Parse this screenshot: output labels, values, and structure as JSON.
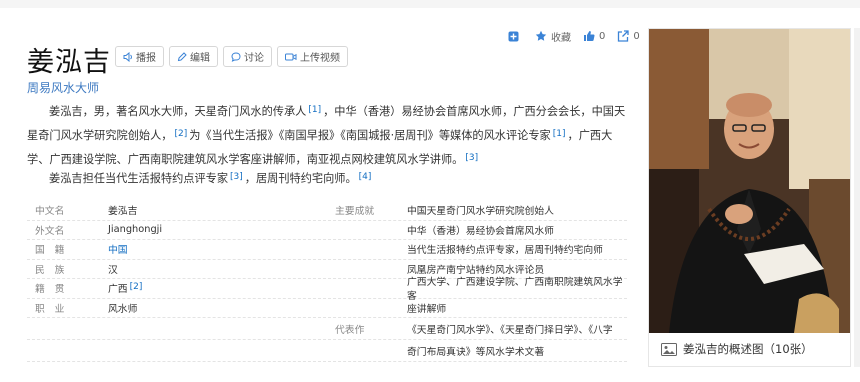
{
  "actions": {
    "collect_label": "收藏",
    "like_count": "0",
    "share_count": "0"
  },
  "header": {
    "title": "姜泓吉",
    "subtitle": "周易风水大师",
    "buttons": [
      "播报",
      "编辑",
      "讨论",
      "上传视频"
    ]
  },
  "summary": {
    "p1_a": "姜泓吉，男，著名风水大师，天星奇门风水的传承人",
    "ref1": "[1]",
    "p1_b": "，中华（香港）易经协会首席风水师，广西分会会长，中国天星奇门风水学研究院创始人，",
    "ref2": "[2]",
    "p1_c": "为《当代生活报》《南国早报》《南国城报·居周刊》等媒体的风水评论专家",
    "ref3": "[1]",
    "p1_d": "，广西大学、广西建设学院、广西南职院建筑风水学客座讲解师，南亚视点网校建筑风水学讲师。",
    "ref4": "[3]",
    "p2_a": "姜泓吉担任当代生活报特约点评专家",
    "ref5": "[3]",
    "p2_b": "，居周刊特约宅向师。",
    "ref6": "[4]"
  },
  "infobox": {
    "rows": [
      {
        "label": "中文名",
        "value": "姜泓吉",
        "label2": "主要成就",
        "value2": "中国天星奇门风水学研究院创始人"
      },
      {
        "label": "外文名",
        "value": "Jianghongji",
        "label2": "",
        "value2": "中华（香港）易经协会首席风水师"
      },
      {
        "label": "国　籍",
        "value": "中国",
        "label2": "",
        "value2": "当代生活报特约点评专家，居周刊特约宅向师"
      },
      {
        "label": "民　族",
        "value": "汉",
        "label2": "",
        "value2": "凤凰房产南宁站特约风水评论员"
      },
      {
        "label": "籍　贯",
        "value": "广西",
        "value_ref": "[2]",
        "label2": "",
        "value2": "广西大学、广西建设学院、广西南职院建筑风水学客"
      },
      {
        "label": "职　业",
        "value": "风水师",
        "label2": "",
        "value2": "座讲解师"
      },
      {
        "label": "",
        "value": "",
        "label2": "代表作",
        "value2": "《天星奇门风水学》、《天星奇门择日学》、《八字"
      },
      {
        "label": "",
        "value": "",
        "label2": "",
        "value2": "奇门布局真诀》等风水学术文著"
      }
    ]
  },
  "image_card": {
    "caption": "姜泓吉的概述图（10张）"
  },
  "colors": {
    "link": "#136ec2",
    "subtitle": "#3d79c1"
  }
}
